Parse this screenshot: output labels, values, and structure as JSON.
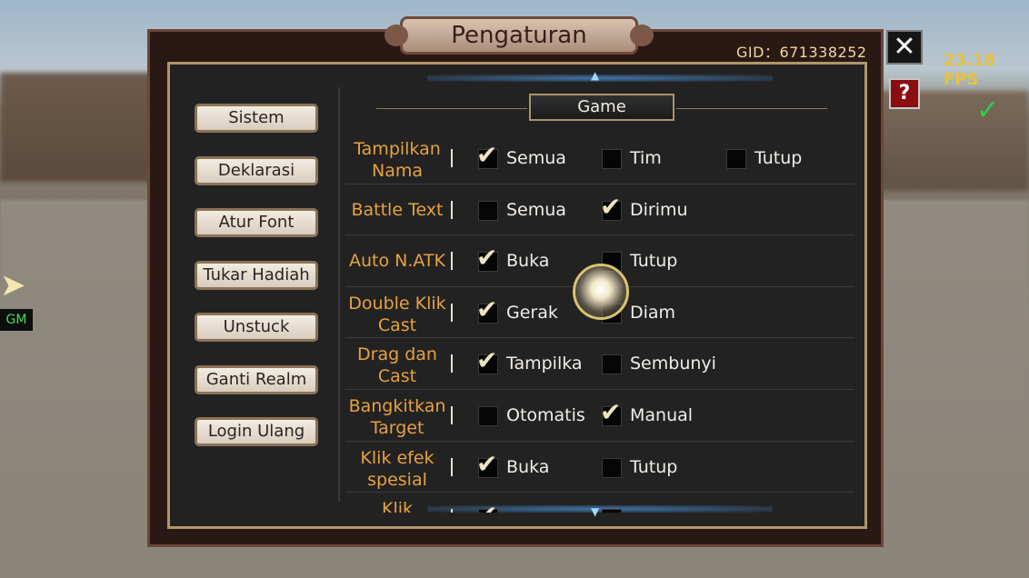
{
  "hud": {
    "gid_label": "GID：671338252",
    "fps": "23.18 FPS",
    "close_symbol": "✕",
    "help_symbol": "?",
    "gm_label": "GM",
    "side_arrow": "➤"
  },
  "dialog": {
    "title": "Pengaturan",
    "section": "Game"
  },
  "side_menu": [
    "Sistem",
    "Deklarasi",
    "Atur Font",
    "Tukar Hadiah",
    "Unstuck",
    "Ganti Realm",
    "Login Ulang"
  ],
  "settings": [
    {
      "label": "Tampilkan Nama",
      "options": [
        {
          "text": "Semua",
          "checked": true
        },
        {
          "text": "Tim",
          "checked": false
        },
        {
          "text": "Tutup",
          "checked": false
        }
      ]
    },
    {
      "label": "Battle Text",
      "options": [
        {
          "text": "Semua",
          "checked": false
        },
        {
          "text": "Dirimu",
          "checked": true
        }
      ]
    },
    {
      "label": "Auto N.ATK",
      "options": [
        {
          "text": "Buka",
          "checked": true
        },
        {
          "text": "Tutup",
          "checked": false
        }
      ]
    },
    {
      "label": "Double Klik Cast",
      "options": [
        {
          "text": "Gerak",
          "checked": true
        },
        {
          "text": "Diam",
          "checked": false
        }
      ]
    },
    {
      "label": "Drag dan Cast",
      "options": [
        {
          "text": "Tampilka",
          "checked": true
        },
        {
          "text": "Sembunyi",
          "checked": false
        }
      ]
    },
    {
      "label": "Bangkitkan Target",
      "options": [
        {
          "text": "Otomatis",
          "checked": false
        },
        {
          "text": "Manual",
          "checked": true
        }
      ]
    },
    {
      "label": "Klik efek spesial",
      "options": [
        {
          "text": "Buka",
          "checked": true
        },
        {
          "text": "Tutup",
          "checked": false
        }
      ]
    },
    {
      "label": "Klik",
      "options": [
        {
          "text": "",
          "checked": true
        },
        {
          "text": "",
          "checked": false
        }
      ]
    }
  ],
  "icons": {
    "check": "✔",
    "scroll_up": "▲",
    "scroll_down": "▼",
    "status": "✓"
  }
}
